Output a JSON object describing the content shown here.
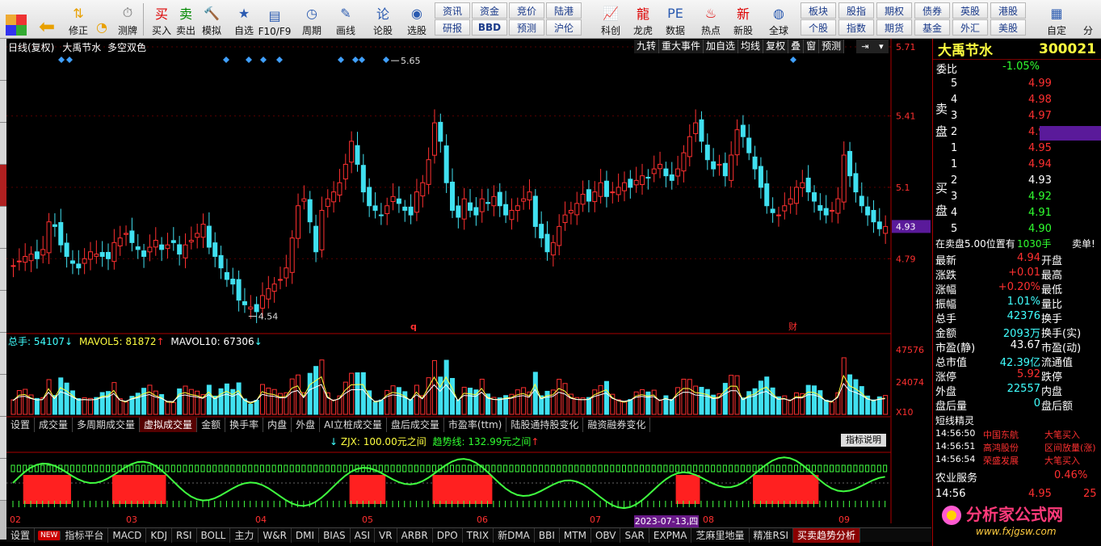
{
  "toolbar": {
    "buttons": [
      {
        "label": "买入",
        "icon": "buy-icon"
      },
      {
        "label": "卖出",
        "icon": "sell-icon"
      },
      {
        "label": "模拟",
        "icon": "hammer-icon"
      },
      {
        "label": "自选",
        "icon": "star-icon"
      },
      {
        "label": "F10/F9",
        "icon": "f10-icon"
      },
      {
        "label": "周期",
        "icon": "clock-icon"
      },
      {
        "label": "画线",
        "icon": "pen-icon"
      },
      {
        "label": "论股",
        "icon": "chat-icon"
      },
      {
        "label": "选股",
        "icon": "select-icon"
      },
      {
        "label": "科创",
        "icon": "chart-icon"
      },
      {
        "label": "龙虎",
        "icon": "dragon-icon"
      },
      {
        "label": "数据",
        "icon": "pe-icon"
      },
      {
        "label": "热点",
        "icon": "fire-icon"
      },
      {
        "label": "新股",
        "icon": "newstock-icon"
      },
      {
        "label": "全球",
        "icon": "globe-icon"
      },
      {
        "label": "自定",
        "icon": "custom-icon"
      }
    ],
    "left_labels": {
      "fix": "修正",
      "test": "测牌"
    },
    "grid_buttons": [
      [
        "资讯",
        "资金",
        "竞价",
        "陆港"
      ],
      [
        "研报",
        "BBD",
        "预测",
        "沪伦"
      ]
    ],
    "grid2": [
      [
        "板块",
        "股指",
        "期权",
        "债券",
        "英股",
        "港股"
      ],
      [
        "个股",
        "指数",
        "期货",
        "基金",
        "外汇",
        "美股"
      ]
    ],
    "last": "分"
  },
  "header": {
    "title": "日线(复权)",
    "stock": "大禹节水",
    "indicator": "多空双色",
    "tools": [
      "九转",
      "重大事件",
      "加自选",
      "均线",
      "复权",
      "叠",
      "窗",
      "预测"
    ]
  },
  "chart_data": {
    "type": "candlestick",
    "title": "大禹节水 日线(复权)",
    "y_ticks": [
      5.71,
      5.41,
      5.1,
      4.79
    ],
    "price_marker": "4.93",
    "high_label": "5.65",
    "low_label": "4.54",
    "events": [
      "q",
      "财"
    ],
    "x_ticks": [
      "02",
      "03",
      "04",
      "05",
      "06",
      "07",
      "08",
      "09"
    ],
    "date_highlight": "2023-07-13,四",
    "series": [
      {
        "name": "candles",
        "values": [
          4.76,
          4.78,
          4.8,
          4.81,
          4.79,
          4.83,
          4.95,
          4.93,
          4.85,
          4.8,
          4.77,
          4.75,
          4.79,
          4.82,
          4.81,
          4.8,
          4.79,
          4.86,
          4.88,
          4.9,
          4.86,
          4.83,
          4.8,
          4.84,
          4.87,
          4.83,
          4.85,
          4.86,
          4.81,
          4.85,
          4.87,
          4.9,
          4.94,
          4.84,
          4.8,
          4.75,
          4.7,
          4.68,
          4.61,
          4.59,
          4.58,
          4.56,
          4.63,
          4.66,
          4.68,
          4.7,
          4.75,
          4.88,
          5.02,
          5.05,
          4.95,
          4.82,
          5.0,
          5.05,
          5.08,
          5.12,
          5.2,
          5.3,
          5.2,
          5.08,
          5.02,
          5.0,
          4.98,
          5.02,
          5.06,
          5.03,
          5.0,
          4.98,
          5.08,
          5.12,
          5.22,
          5.38,
          5.3,
          5.12,
          5.0,
          4.97,
          5.05,
          5.0,
          4.98,
          5.05,
          5.03,
          5.06,
          5.02,
          4.98,
          5.0,
          5.02,
          5.05,
          5.08,
          4.93,
          4.88,
          4.82,
          4.86,
          4.93,
          4.98,
          5.0,
          5.03,
          5.07,
          5.04,
          5.08,
          5.12,
          5.06,
          5.08,
          5.1,
          5.12,
          5.1,
          5.13,
          5.15,
          5.14,
          5.18,
          5.2,
          5.15,
          5.13,
          5.18,
          5.25,
          5.32,
          5.38,
          5.3,
          5.22,
          5.18,
          5.2,
          5.15,
          5.24,
          5.35,
          5.32,
          5.25,
          5.18,
          5.1,
          5.02,
          4.99,
          4.98,
          5.02,
          5.05,
          5.1,
          5.12,
          5.08,
          5.04,
          5.0,
          4.98,
          5.0,
          5.05,
          5.24,
          5.15,
          5.08,
          5.02,
          4.98,
          4.95,
          4.92,
          4.93
        ]
      }
    ],
    "volume": {
      "label_total": "总手: 54107",
      "label_ma5": "MAVOL5: 81872",
      "label_ma10": "MAVOL10: 67306",
      "y_ticks": [
        "47576",
        "24074",
        "X10"
      ]
    },
    "indicator": {
      "label": "ZJX: 100.00元之间",
      "label2": "趋势线: 132.99元之间",
      "button": "指标说明"
    }
  },
  "main_tabs": [
    "设置",
    "成交量",
    "多周期成交量",
    "虚拟成交量",
    "金额",
    "换手率",
    "内盘",
    "外盘",
    "AI立桩成交量",
    "盘后成交量",
    "市盈率(ttm)",
    "陆股通持股变化",
    "融资融券变化"
  ],
  "bottom_tabs": [
    "设置",
    "NEW",
    "指标平台",
    "MACD",
    "KDJ",
    "RSI",
    "BOLL",
    "主力",
    "W&R",
    "DMI",
    "BIAS",
    "ASI",
    "VR",
    "ARBR",
    "DPO",
    "TRIX",
    "新DMA",
    "BBI",
    "MTM",
    "OBV",
    "SAR",
    "EXPMA",
    "芝麻里地量",
    "精准RSI",
    "买卖趋势分析"
  ],
  "quote": {
    "name": "大禹节水",
    "code": "300021",
    "weibi_label": "委比",
    "weibi": "-1.05%",
    "sell_label": [
      "卖",
      "盘"
    ],
    "buy_label": [
      "买",
      "盘"
    ],
    "sell": [
      [
        "5",
        "4.99"
      ],
      [
        "4",
        "4.98"
      ],
      [
        "3",
        "4.97"
      ],
      [
        "2",
        "4.96"
      ],
      [
        "1",
        "4.95"
      ]
    ],
    "buy": [
      [
        "1",
        "4.94"
      ],
      [
        "2",
        "4.93"
      ],
      [
        "3",
        "4.92"
      ],
      [
        "4",
        "4.91"
      ],
      [
        "5",
        "4.90"
      ]
    ],
    "notice": "在卖盘5.00位置有",
    "notice_vol": "1030手",
    "notice_tag": "卖单!",
    "stats": [
      [
        "最新",
        "4.94",
        "开盘"
      ],
      [
        "涨跌",
        "+0.01",
        "最高"
      ],
      [
        "涨幅",
        "+0.20%",
        "最低"
      ],
      [
        "振幅",
        "1.01%",
        "量比"
      ],
      [
        "总手",
        "42376",
        "换手"
      ],
      [
        "金额",
        "2093万",
        "换手(实)"
      ],
      [
        "市盈(静)",
        "43.67",
        "市盈(动)"
      ],
      [
        "总市值",
        "42.39亿",
        "流通值"
      ],
      [
        "涨停",
        "5.92",
        "跌停"
      ],
      [
        "外盘",
        "22557",
        "内盘"
      ],
      [
        "盘后量",
        "0",
        "盘后额"
      ]
    ],
    "short_title": "短线精灵",
    "short": [
      [
        "14:56:50",
        "中国东航",
        "大笔买入"
      ],
      [
        "14:56:51",
        "高鸿股份",
        "区间放量(涨)"
      ],
      [
        "14:56:54",
        "荣盛发展",
        "大笔买入"
      ]
    ],
    "sector": "农业服务",
    "sector_pct": "0.46%",
    "tick_time": "14:56",
    "tick_price": "4.95",
    "tick_vol": "25"
  },
  "watermark": {
    "text": "分析家公式网",
    "url": "www.fxjgsw.com"
  }
}
